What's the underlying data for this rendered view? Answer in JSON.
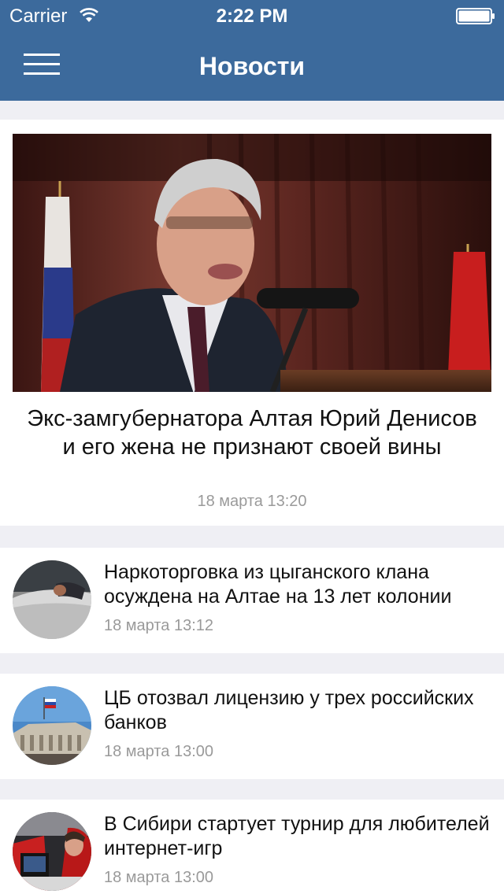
{
  "status_bar": {
    "carrier": "Carrier",
    "time": "2:22 PM"
  },
  "nav": {
    "title": "Новости"
  },
  "featured": {
    "title": "Экс-замгубернатора Алтая Юрий Денисов и его жена не признают своей вины",
    "date": "18 марта 13:20"
  },
  "news": [
    {
      "title": "Наркоторговка из цыганского клана осуждена на Алтае на 13 лет колонии",
      "date": "18 марта 13:12"
    },
    {
      "title": "ЦБ отозвал лицензию у трех российских банков",
      "date": "18 марта 13:00"
    },
    {
      "title": "В Сибири стартует турнир для любителей интернет-игр",
      "date": "18 марта 13:00"
    }
  ],
  "colors": {
    "header_bg": "#3c6a9c",
    "feed_bg": "#efeff4",
    "date_text": "#9a9a9a"
  }
}
